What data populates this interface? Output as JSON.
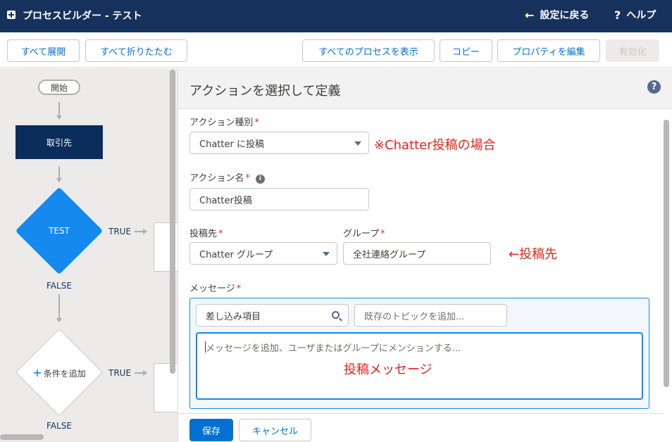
{
  "header": {
    "title": "プロセスビルダー - テスト",
    "back_label": "設定に戻る",
    "help_label": "ヘルプ"
  },
  "toolbar": {
    "expand_all": "すべて展開",
    "collapse_all": "すべて折りたたむ",
    "view_all": "すべてのプロセスを表示",
    "copy": "コピー",
    "edit_properties": "プロパティを編集",
    "activate": "有効化"
  },
  "canvas": {
    "start_label": "開始",
    "object_label": "取引先",
    "criteria_label": "TEST",
    "add_criteria_label": "条件を追加",
    "true_label_1": "TRUE",
    "true_label_2": "TRUE",
    "false_label_1": "FALSE",
    "false_label_2": "FALSE"
  },
  "panel": {
    "title": "アクションを選択して定義",
    "action_type_label": "アクション種別",
    "action_type_value": "Chatter に投稿",
    "action_name_label": "アクション名",
    "action_name_value": "Chatter投稿",
    "post_to_label": "投稿先",
    "post_to_value": "Chatter グループ",
    "group_label": "グループ",
    "group_value": "全社連絡グループ",
    "message_label": "メッセージ",
    "merge_field_value": "差し込み項目",
    "topic_placeholder": "既存のトピックを追加...",
    "message_placeholder": "メッセージを追加、ユーザまたはグループにメンションする...",
    "required_mark": "*"
  },
  "annotations": {
    "chatter_note": "※Chatter投稿の場合",
    "post_to_note": "←投稿先",
    "message_note": "投稿メッセージ"
  },
  "footer": {
    "save": "保存",
    "cancel": "キャンセル"
  },
  "colors": {
    "header_bg": "#16325c",
    "brand_blue": "#0070d2",
    "criteria_blue": "#1589ee",
    "annotation_red": "#e3231b"
  }
}
